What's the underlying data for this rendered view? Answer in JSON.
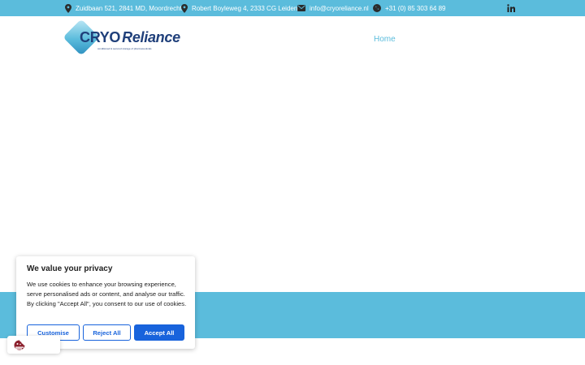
{
  "topbar": {
    "address1": "Zuidbaan 521, 2841 MD, Moordrecht",
    "address2": "Robert Boyleweg 4, 2333 CG Leiden",
    "email": "info@cryoreliance.nl",
    "phone": "+31 (0) 85 303 64 89",
    "icons": [
      "map-pin-icon",
      "map-pin-icon",
      "envelope-icon",
      "whatsapp-icon",
      "linkedin-icon"
    ]
  },
  "header": {
    "logo_text_cryo": "CRYO",
    "logo_text_reliance": "Reliance",
    "logo_tagline": "conditioned & secured storage of pharmaceuticals",
    "nav": [
      {
        "label": "Home"
      }
    ]
  },
  "consent": {
    "title": "We value your privacy",
    "description": "We use cookies to enhance your browsing experience, serve personalised ads or content, and analyse our traffic. By clicking \"Accept All\", you consent to our use of cookies.",
    "buttons": {
      "customise": "Customise",
      "reject": "Reject All",
      "accept": "Accept All"
    }
  },
  "colors": {
    "accent": "#5bbcdc",
    "brand_dark": "#1f3f7a",
    "consent_button": "#1863dc",
    "text": "#212121"
  }
}
